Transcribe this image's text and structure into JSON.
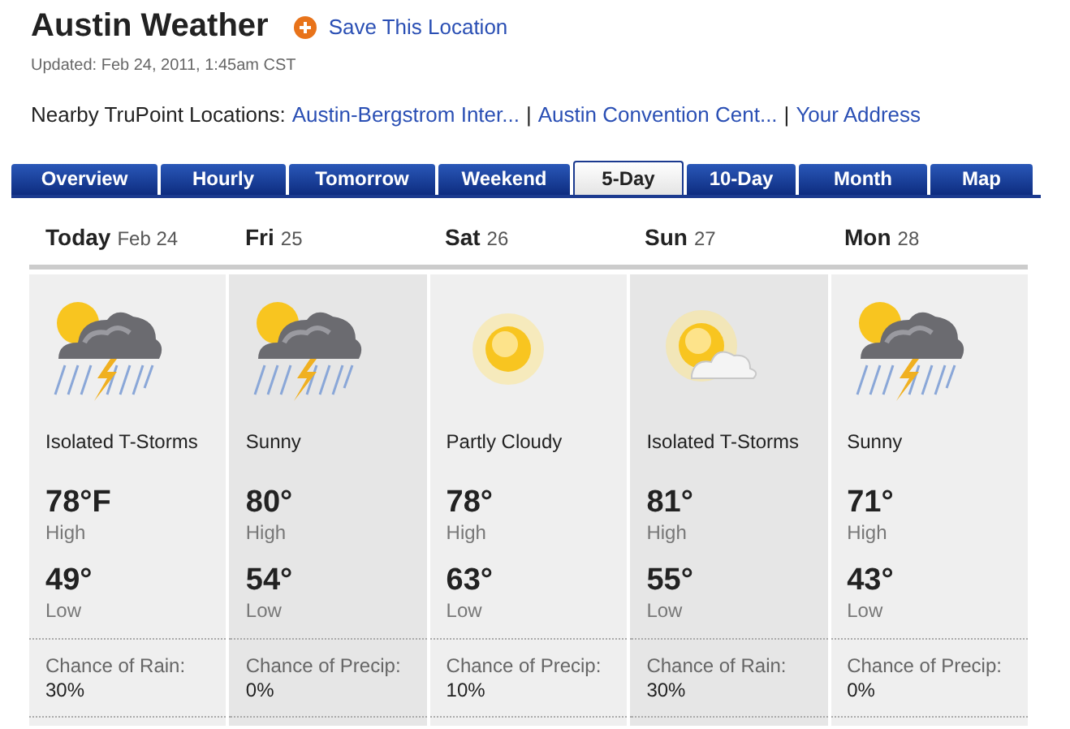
{
  "title": "Austin Weather",
  "save_link": "Save This Location",
  "updated": "Updated: Feb 24, 2011, 1:45am CST",
  "nearby": {
    "label": "Nearby TruPoint Locations:",
    "links": [
      "Austin-Bergstrom Inter...",
      "Austin Convention Cent...",
      "Your Address"
    ],
    "separator": "|"
  },
  "tabs": [
    {
      "label": "Overview",
      "selected": false
    },
    {
      "label": "Hourly",
      "selected": false
    },
    {
      "label": "Tomorrow",
      "selected": false
    },
    {
      "label": "Weekend",
      "selected": false
    },
    {
      "label": "5-Day",
      "selected": true
    },
    {
      "label": "10-Day",
      "selected": false
    },
    {
      "label": "Month",
      "selected": false
    },
    {
      "label": "Map",
      "selected": false
    }
  ],
  "days": [
    {
      "day": "Today",
      "date": "Feb 24",
      "kind": "storm",
      "condition": "Isolated T-Storms",
      "high": "78°F",
      "high_label": "High",
      "low": "49°",
      "low_label": "Low",
      "chance_label": "Chance of Rain:",
      "chance": "30%"
    },
    {
      "day": "Fri",
      "date": "25",
      "kind": "storm",
      "condition": "Sunny",
      "high": "80°",
      "high_label": "High",
      "low": "54°",
      "low_label": "Low",
      "chance_label": "Chance of Precip:",
      "chance": "0%"
    },
    {
      "day": "Sat",
      "date": "26",
      "kind": "sun",
      "condition": "Partly Cloudy",
      "high": "78°",
      "high_label": "High",
      "low": "63°",
      "low_label": "Low",
      "chance_label": "Chance of Precip:",
      "chance": "10%"
    },
    {
      "day": "Sun",
      "date": "27",
      "kind": "partly",
      "condition": "Isolated T-Storms",
      "high": "81°",
      "high_label": "High",
      "low": "55°",
      "low_label": "Low",
      "chance_label": "Chance of Rain:",
      "chance": "30%"
    },
    {
      "day": "Mon",
      "date": "28",
      "kind": "storm",
      "condition": "Sunny",
      "high": "71°",
      "high_label": "High",
      "low": "43°",
      "low_label": "Low",
      "chance_label": "Chance of Precip:",
      "chance": "0%"
    }
  ]
}
